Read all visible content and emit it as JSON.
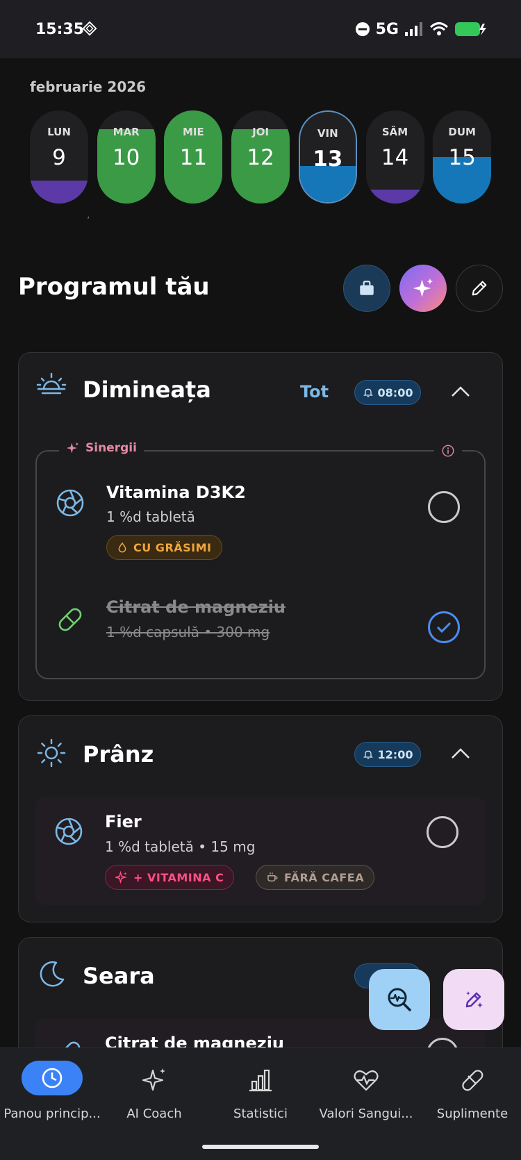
{
  "status_bar": {
    "time": "15:35",
    "network": "5G",
    "icons": [
      "diamond-icon",
      "dnd-icon",
      "signal-icon",
      "wifi-icon",
      "battery-charging-icon"
    ]
  },
  "calendar": {
    "month": "februarie 2026",
    "days": [
      {
        "name": "LUN",
        "num": "9",
        "fill_color": "#5b3aa8",
        "fill_level": 0.25
      },
      {
        "name": "MAR",
        "num": "10",
        "fill_color": "#3a9a45",
        "fill_level": 0.8
      },
      {
        "name": "MIE",
        "num": "11",
        "fill_color": "#3a9a45",
        "fill_level": 1.0
      },
      {
        "name": "JOI",
        "num": "12",
        "fill_color": "#3a9a45",
        "fill_level": 0.8
      },
      {
        "name": "VIN",
        "num": "13",
        "fill_color": "#1577b8",
        "fill_level": 0.4,
        "selected": true
      },
      {
        "name": "SÂM",
        "num": "14",
        "fill_color": "#5b3aa8",
        "fill_level": 0.15
      },
      {
        "name": "DUM",
        "num": "15",
        "fill_color": "#1577b8",
        "fill_level": 0.5
      }
    ]
  },
  "tick_mark": "ʼ",
  "program": {
    "title": "Programul tău",
    "actions": [
      "shopping-bag-icon",
      "sparkles-icon",
      "pencil-icon"
    ]
  },
  "sections": {
    "morning": {
      "title": "Dimineața",
      "all_label": "Tot",
      "time": "08:00",
      "synergy_label": "Sinergii",
      "items": [
        {
          "name": "Vitamina D3K2",
          "dose": "1 %d tabletă",
          "tag": "CU GRĂSIMI",
          "done": false
        },
        {
          "name": "Citrat de magneziu",
          "dose": "1 %d capsulă",
          "amount": "300 mg",
          "done": true
        }
      ]
    },
    "noon": {
      "title": "Prânz",
      "time": "12:00",
      "items": [
        {
          "name": "Fier",
          "dose": "1 %d tabletă",
          "amount": "15 mg",
          "tags": [
            "+ VITAMINA C",
            "FĂRĂ CAFEA"
          ],
          "done": false
        }
      ]
    },
    "evening": {
      "title": "Seara",
      "items": [
        {
          "name": "Citrat de magneziu",
          "done": false
        }
      ]
    }
  },
  "colors": {
    "accent": "#3b82f6",
    "background": "#121212",
    "card": "#1c1c1e"
  },
  "nav": [
    {
      "label": "Panou princip...",
      "icon": "clock-icon",
      "active": true
    },
    {
      "label": "AI Coach",
      "icon": "sparkles-icon",
      "active": false
    },
    {
      "label": "Statistici",
      "icon": "bar-chart-icon",
      "active": false
    },
    {
      "label": "Valori Sangui...",
      "icon": "heart-pulse-icon",
      "active": false
    },
    {
      "label": "Suplimente",
      "icon": "pill-icon",
      "active": false
    }
  ]
}
